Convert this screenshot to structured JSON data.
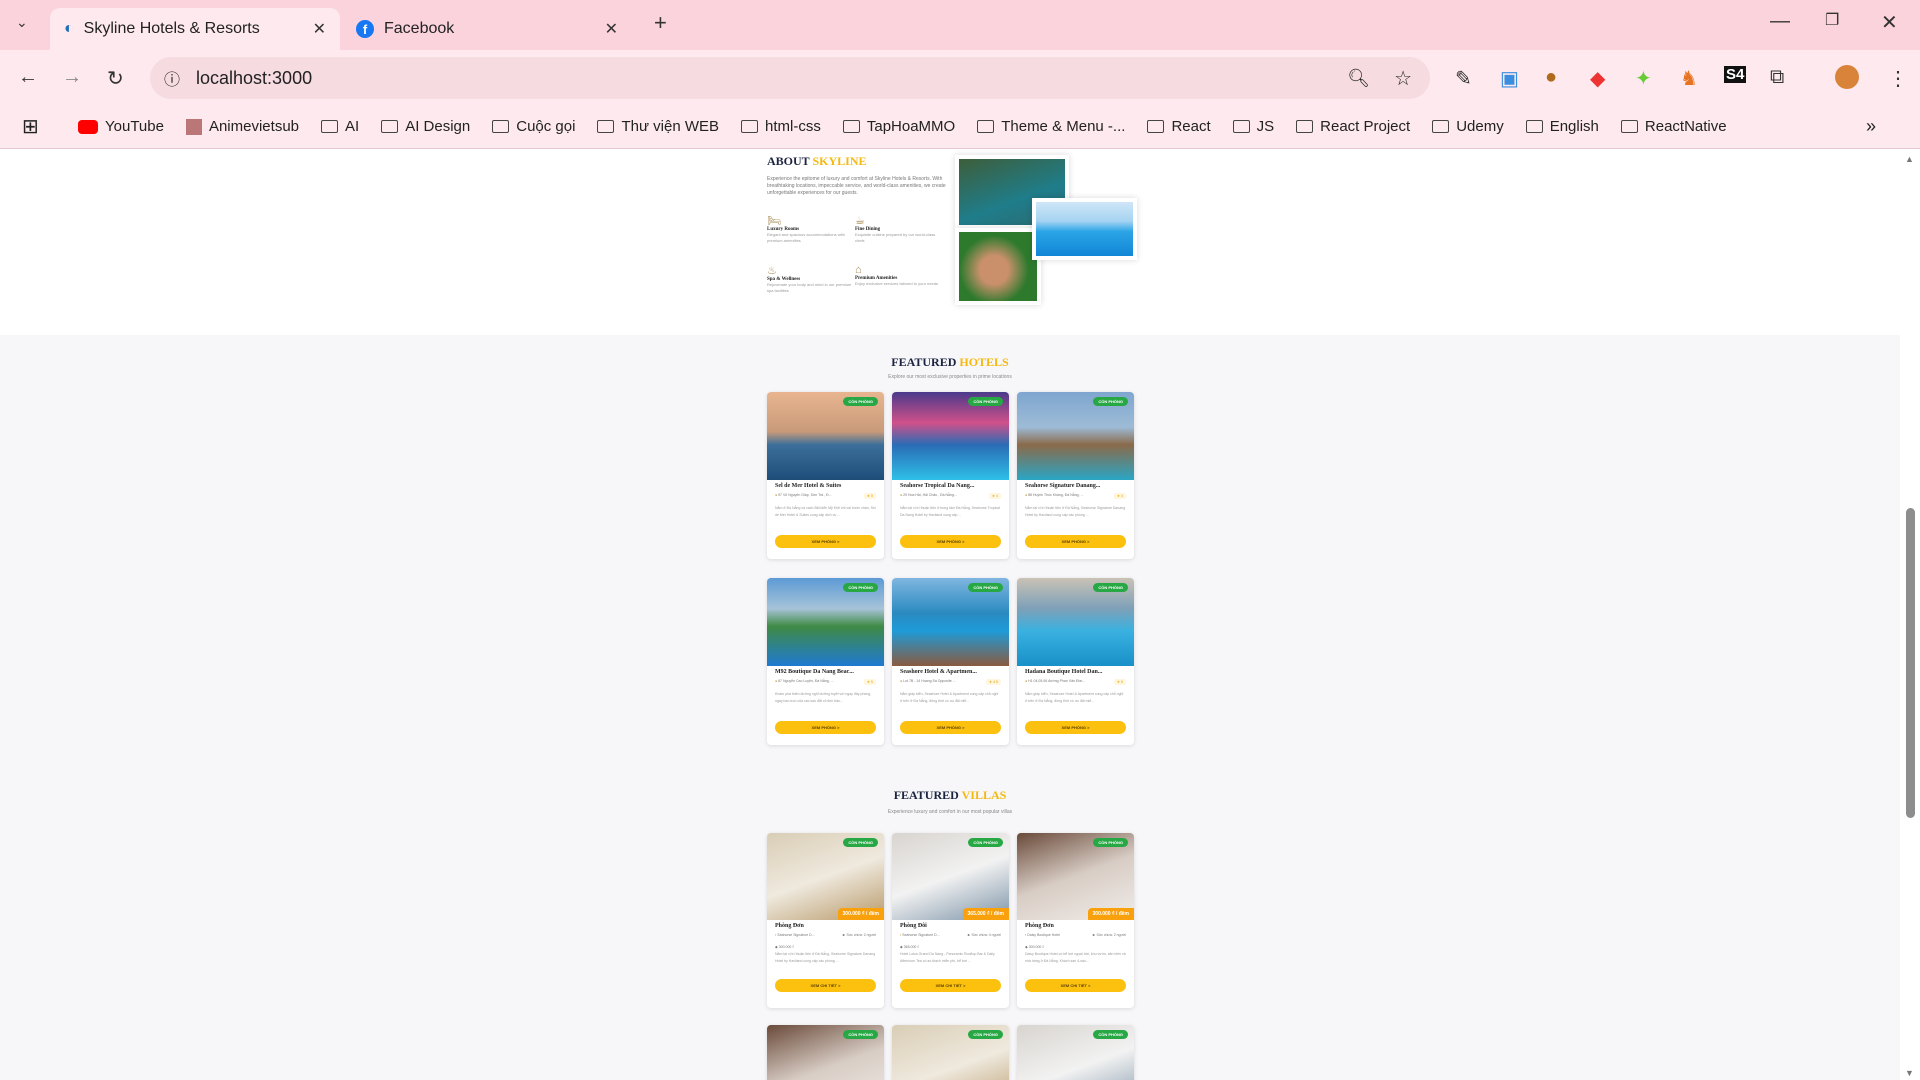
{
  "browser": {
    "tabs": [
      {
        "title": "Skyline Hotels & Resorts",
        "active": true
      },
      {
        "title": "Facebook",
        "active": false
      }
    ],
    "url": "localhost:3000",
    "bookmarks": [
      "YouTube",
      "Animevietsub",
      "AI",
      "AI Design",
      "Cuộc gọi",
      "Thư viện WEB",
      "html-css",
      "TapHoaMMO",
      "Theme & Menu -...",
      "React",
      "JS",
      "React Project",
      "Udemy",
      "English",
      "ReactNative"
    ]
  },
  "about": {
    "title_a": "ABOUT",
    "title_b": "SKYLINE",
    "desc": "Experience the epitome of luxury and comfort at Skyline Hotels & Resorts. With breathtaking locations, impeccable service, and world-class amenities, we create unforgettable experiences for our guests.",
    "features": [
      {
        "icon": "bed-icon",
        "title": "Luxury Rooms",
        "text": "Elegant and spacious accommodations with premium amenities"
      },
      {
        "icon": "dining-icon",
        "title": "Fine Dining",
        "text": "Exquisite cuisine prepared by our world-class chefs"
      },
      {
        "icon": "spa-icon",
        "title": "Spa & Wellness",
        "text": "Rejuvenate your body and mind in our premium spa facilities"
      },
      {
        "icon": "amenities-icon",
        "title": "Premium Amenities",
        "text": "Enjoy exclusive services tailored to your needs"
      }
    ]
  },
  "hotels": {
    "title_a": "FEATURED",
    "title_b": "HOTELS",
    "subtitle": "Explore our most exclusive properties in prime locations",
    "badge": "CÒN PHÒNG",
    "button": "XEM PHÒNG >",
    "items": [
      {
        "name": "Sel de Mer Hotel & Suites",
        "address": "97 Võ Nguyên Giáp, Sơn Trà , Đ...",
        "rating": "5",
        "desc": "Nằm ở Đà Nẵng và cách Bãi biển Mỹ Khê chỉ vài bước chân, Sel de Mer Hotel & Suites cung cấp dịch vụ ..."
      },
      {
        "name": "Seahorse Tropical Da Nang...",
        "address": "29 Hoa Hải, Hải Châu , Đà Nẵng...",
        "rating": "4",
        "desc": "Nằm tại vị trí thuận tiện ở trung tâm Đà Nẵng, Seahorse Tropical Da Nang Hotel by Haviland cung cấp ..."
      },
      {
        "name": "Seahorse Signature Danang...",
        "address": "88 Huỳnh Thúc Kháng, Đà Nẵng, ...",
        "rating": "4",
        "desc": "Nằm tại vị trí thuận tiện ở Đà Nẵng, Seahorse Signature Danang Hotel by Haviland cung cấp các phòng ..."
      },
      {
        "name": "M92 Boutique Da Nang Beac...",
        "address": "87 Nguyễn Cao Luyện, Đà Nẵng, ...",
        "rating": "5",
        "desc": "Khám phá thiên đường nghỉ dưỡng tuyệt vời ngay đây phòng, ngày bao trọn của các sau đắt cỏ tiền bảo..."
      },
      {
        "name": "Seashore Hotel & Apartmen...",
        "address": "Lot 7B - 14 Hoang Sa Opposite ...",
        "rating": "4.5",
        "desc": "Nằm giáp biển, Seashore Hotel & Apartment cung cấp chỗ nghỉ ở trên ở Đà Nẵng, đồng thời có ưu đãi miễ..."
      },
      {
        "name": "Hadana Boutique Hotel Dan...",
        "address": "H1 04,05,06 đường Phan Văn Đồn...",
        "rating": "5",
        "desc": "Nằm giáp biển, Seashore Hotel & Apartment cung cấp chỗ nghỉ ở trên ở Đà Nẵng, đồng thời có ưu đãi miễ..."
      }
    ]
  },
  "villas": {
    "title_a": "FEATURED",
    "title_b": "VILLAS",
    "subtitle": "Experience luxury and comfort in our most popular villas",
    "badge": "CÒN PHÒNG",
    "button": "XEM CHI TIẾT >",
    "items": [
      {
        "name": "Phòng Đơn",
        "price": "300.000 ₫ / đêm",
        "hotel": "Seahorse Signature D...",
        "capacity": "Sức chứa: 2 người",
        "small_price": "300.000 ₫",
        "desc": "Nằm tại vị trí thuận tiện ở Đà Nẵng, Seahorse Signature Danang Hotel by Haviland cung cấp các phòng ..."
      },
      {
        "name": "Phòng Đôi",
        "price": "365.000 ₫ / đêm",
        "hotel": "Seahorse Signature D...",
        "capacity": "Sức chứa: 4 người",
        "small_price": "365.000 ₫",
        "desc": "Hotel Lotus Grand Da Nang - Panoramic Rooftop Bar & Daily Afternoon Tea có ao thạch miễn phí, bể bơi ..."
      },
      {
        "name": "Phòng Đơn",
        "price": "300.000 ₫ / đêm",
        "hotel": "Daisy Boutique Hotel",
        "capacity": "Sức chứa: 2 người",
        "small_price": "300.000 ₫",
        "desc": "Daisy Boutique Hotel có bể bơi ngoài trời, khu vườn, sân hiên và nhà hàng ở Đà Nẵng. Khách sạn 4-sao..."
      }
    ]
  },
  "colors": {
    "accent": "#f5b80d",
    "badge": "#28a745",
    "button": "#fcc00f",
    "tabbar": "#fbd3dc"
  }
}
